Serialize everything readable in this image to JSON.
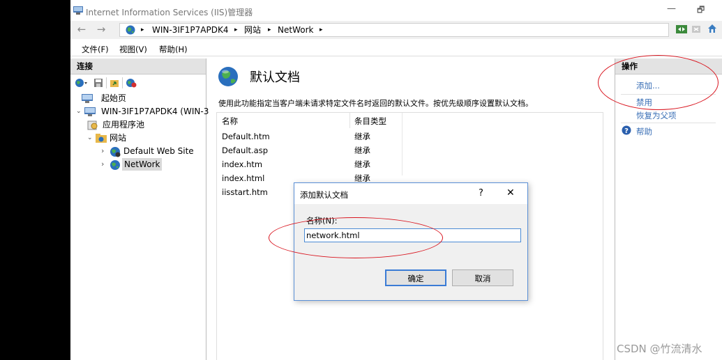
{
  "window": {
    "title": "Internet Information Services (IIS)管理器",
    "minimize": "—",
    "restore": "🗗"
  },
  "address": {
    "back": "←",
    "forward": "→",
    "crumbs": [
      "WIN-3IF1P7APDK4",
      "网站",
      "NetWork"
    ],
    "separator": "▸"
  },
  "menu": {
    "file": "文件(F)",
    "view": "视图(V)",
    "help": "帮助(H)"
  },
  "connections": {
    "header": "连接",
    "tree": {
      "start_page": "起始页",
      "server": "WIN-3IF1P7APDK4 (WIN-3",
      "app_pools": "应用程序池",
      "sites": "网站",
      "default_site": "Default Web Site",
      "network": "NetWork"
    }
  },
  "main": {
    "title": "默认文档",
    "description": "使用此功能指定当客户端未请求特定文件名时返回的默认文件。按优先级顺序设置默认文档。",
    "columns": [
      "名称",
      "条目类型"
    ],
    "rows": [
      {
        "name": "Default.htm",
        "type": "继承"
      },
      {
        "name": "Default.asp",
        "type": "继承"
      },
      {
        "name": "index.htm",
        "type": "继承"
      },
      {
        "name": "index.html",
        "type": "继承"
      },
      {
        "name": "iisstart.htm",
        "type": ""
      }
    ]
  },
  "actions": {
    "header": "操作",
    "add": "添加...",
    "disable": "禁用",
    "revert": "恢复为父项",
    "help": "帮助"
  },
  "dialog": {
    "title": "添加默认文档",
    "help_btn": "?",
    "close_btn": "✕",
    "name_label": "名称(N):",
    "name_value": "network.html",
    "ok": "确定",
    "cancel": "取消"
  },
  "watermark": "CSDN @竹流清水",
  "colors": {
    "annotation": "#d9141e",
    "link": "#3a6fb6",
    "dialog_border": "#5a8fd6"
  }
}
